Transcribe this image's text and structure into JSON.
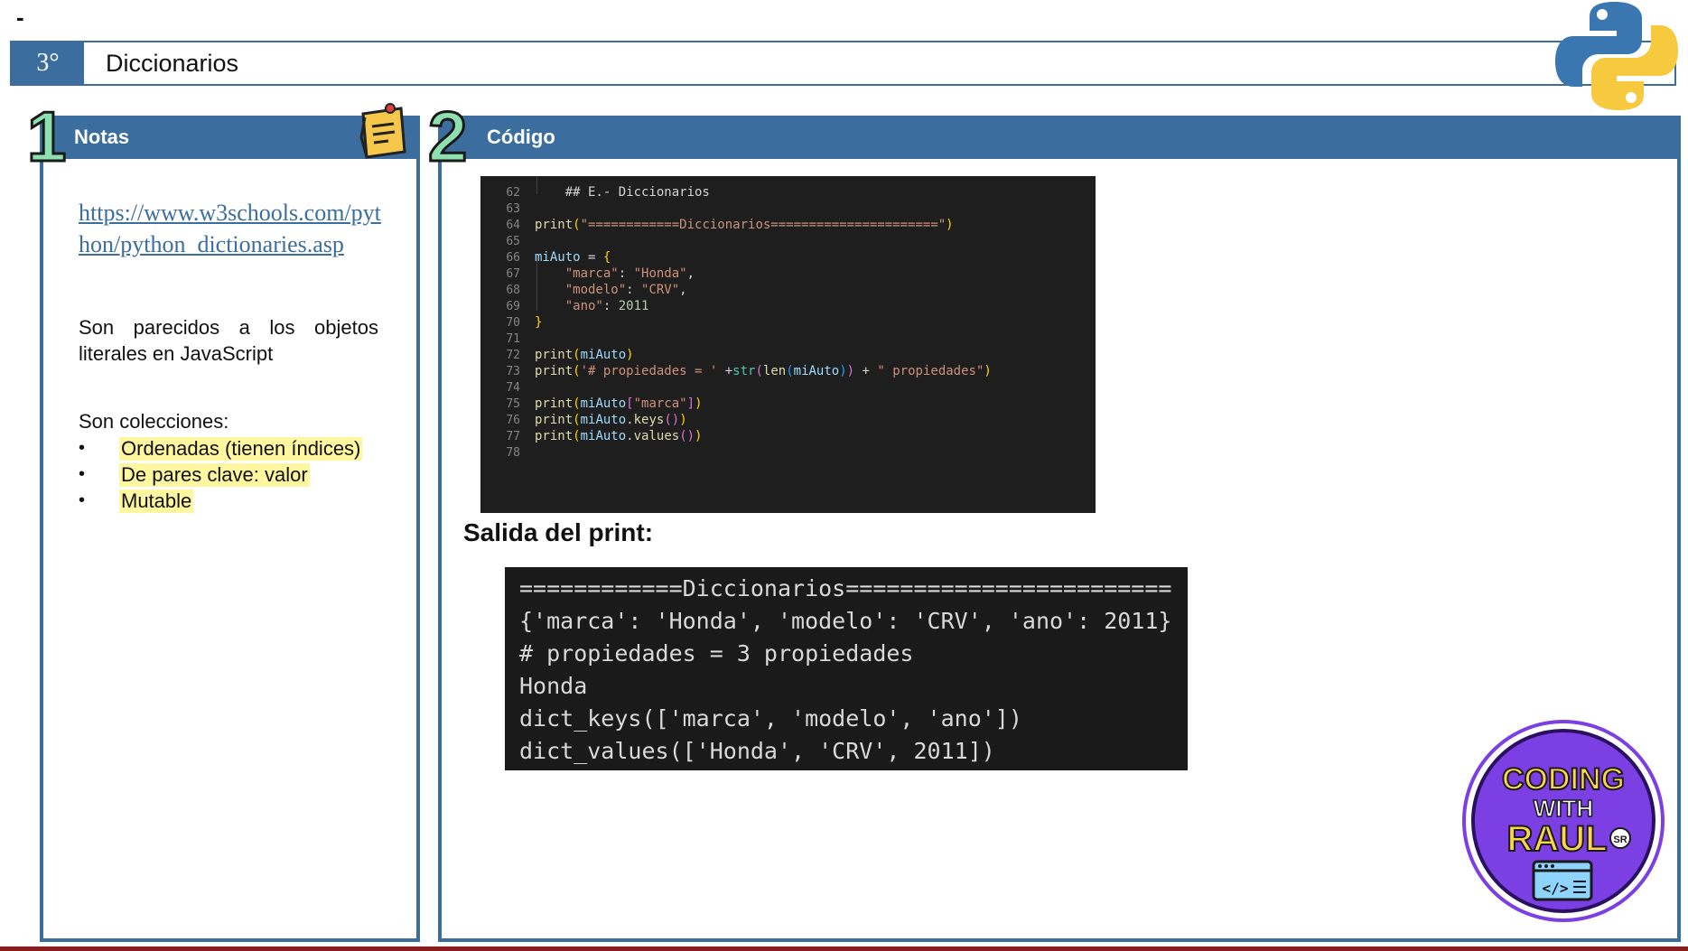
{
  "dash": "-",
  "header": {
    "number": "3°",
    "title": "Diccionarios"
  },
  "notes": {
    "number": "1",
    "title": "Notas",
    "link": "https://www.w3schools.com/python/python_dictionaries.asp",
    "paragraph": "Son parecidos a los objetos literales en JavaScript",
    "list_heading": "Son colecciones:",
    "items": [
      "Ordenadas (tienen índices)",
      "De pares clave: valor",
      "Mutable"
    ],
    "bullet": "•"
  },
  "code": {
    "number": "2",
    "title": "Código",
    "line_numbers": [
      "62",
      "63",
      "64",
      "65",
      "66",
      "67",
      "68",
      "69",
      "70",
      "71",
      "72",
      "73",
      "74",
      "75",
      "76",
      "77",
      "78"
    ],
    "lines": [
      "    ## E.- Diccionarios",
      "",
      "print(\"============Diccionarios======================\")",
      "",
      "miAuto = {",
      "    \"marca\": \"Honda\",",
      "    \"modelo\": \"CRV\",",
      "    \"ano\": 2011",
      "}",
      "",
      "print(miAuto)",
      "print('# propiedades = ' +str(len(miAuto)) + \" propiedades\")",
      "",
      "print(miAuto[\"marca\"])",
      "print(miAuto.keys())",
      "print(miAuto.values())",
      ""
    ]
  },
  "output": {
    "label": "Salida del print:",
    "lines": [
      "============Diccionarios========================",
      "{'marca': 'Honda', 'modelo': 'CRV', 'ano': 2011}",
      "# propiedades = 3 propiedades",
      "Honda",
      "dict_keys(['marca', 'modelo', 'ano'])",
      "dict_values(['Honda', 'CRV', 2011])"
    ]
  },
  "badge": {
    "line1": "CODING",
    "line2": "WITH",
    "line3": "RAUL",
    "tag": "SR"
  },
  "colors": {
    "primary": "#3b6e9e",
    "highlight": "#fff6a0",
    "accent_green": "#8ee0b0",
    "badge_purple": "#7b3fe4"
  },
  "icons": [
    "python-logo-icon",
    "memo-note-icon",
    "code-window-icon"
  ]
}
